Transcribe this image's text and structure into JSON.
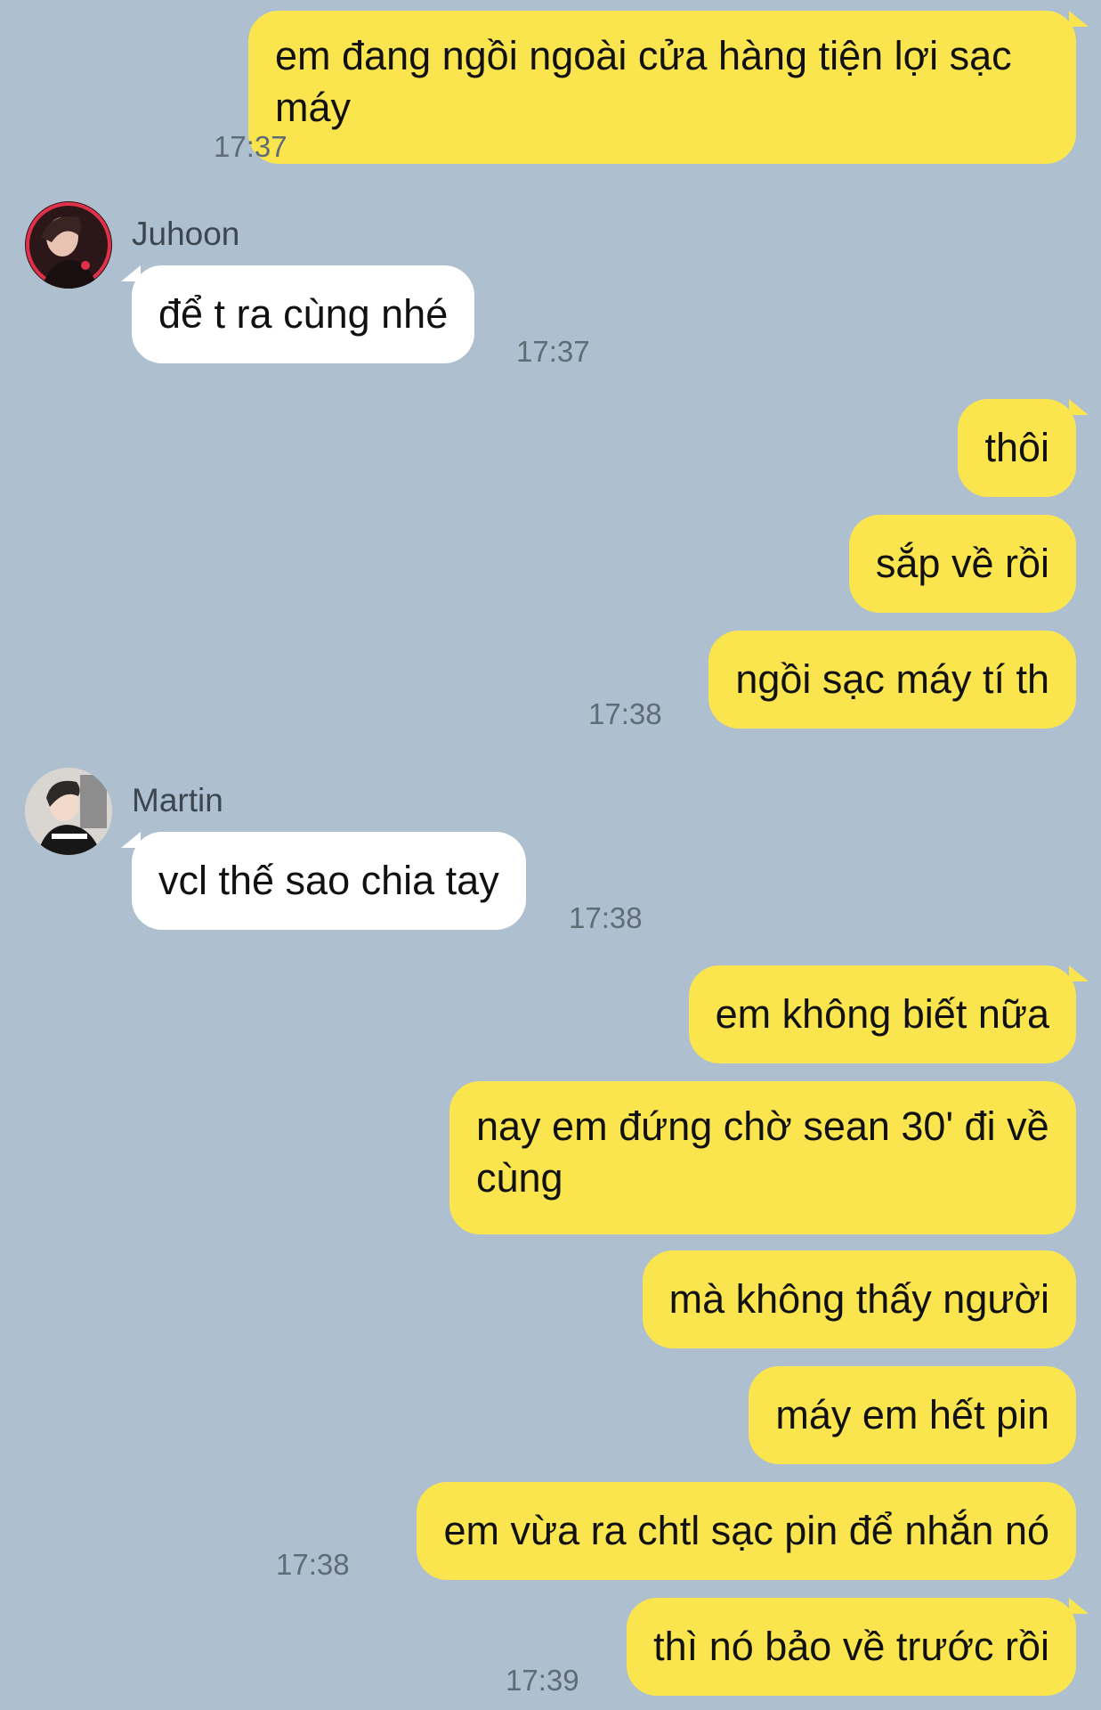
{
  "colors": {
    "background": "#aebfcf",
    "my_bubble": "#fbe54f",
    "their_bubble": "#ffffff",
    "timestamp": "#5f6b76"
  },
  "messages": [
    {
      "sender": "me",
      "text": "em đang ngồi ngoài cửa hàng tiện lợi sạc máy",
      "time": "17:37"
    },
    {
      "sender": "Juhoon",
      "text": "để t ra cùng nhé",
      "time": "17:37"
    },
    {
      "sender": "me",
      "text": "thôi",
      "time": ""
    },
    {
      "sender": "me",
      "text": "sắp về rồi",
      "time": ""
    },
    {
      "sender": "me",
      "text": "ngồi sạc máy tí th",
      "time": "17:38"
    },
    {
      "sender": "Martin",
      "text": "vcl thế sao chia tay",
      "time": "17:38"
    },
    {
      "sender": "me",
      "text": "em không biết nữa",
      "time": ""
    },
    {
      "sender": "me",
      "text": "nay em đứng chờ sean 30' đi về cùng",
      "time": ""
    },
    {
      "sender": "me",
      "text": "mà không thấy người",
      "time": ""
    },
    {
      "sender": "me",
      "text": "máy em hết pin",
      "time": ""
    },
    {
      "sender": "me",
      "text": "em vừa ra chtl sạc pin để nhắn nó",
      "time": "17:38"
    },
    {
      "sender": "me",
      "text": "thì nó bảo về trước rồi",
      "time": "17:39"
    }
  ],
  "senders": {
    "juhoon": {
      "name": "Juhoon",
      "avatar_icon": "profile-photo"
    },
    "martin": {
      "name": "Martin",
      "avatar_icon": "profile-photo"
    }
  }
}
